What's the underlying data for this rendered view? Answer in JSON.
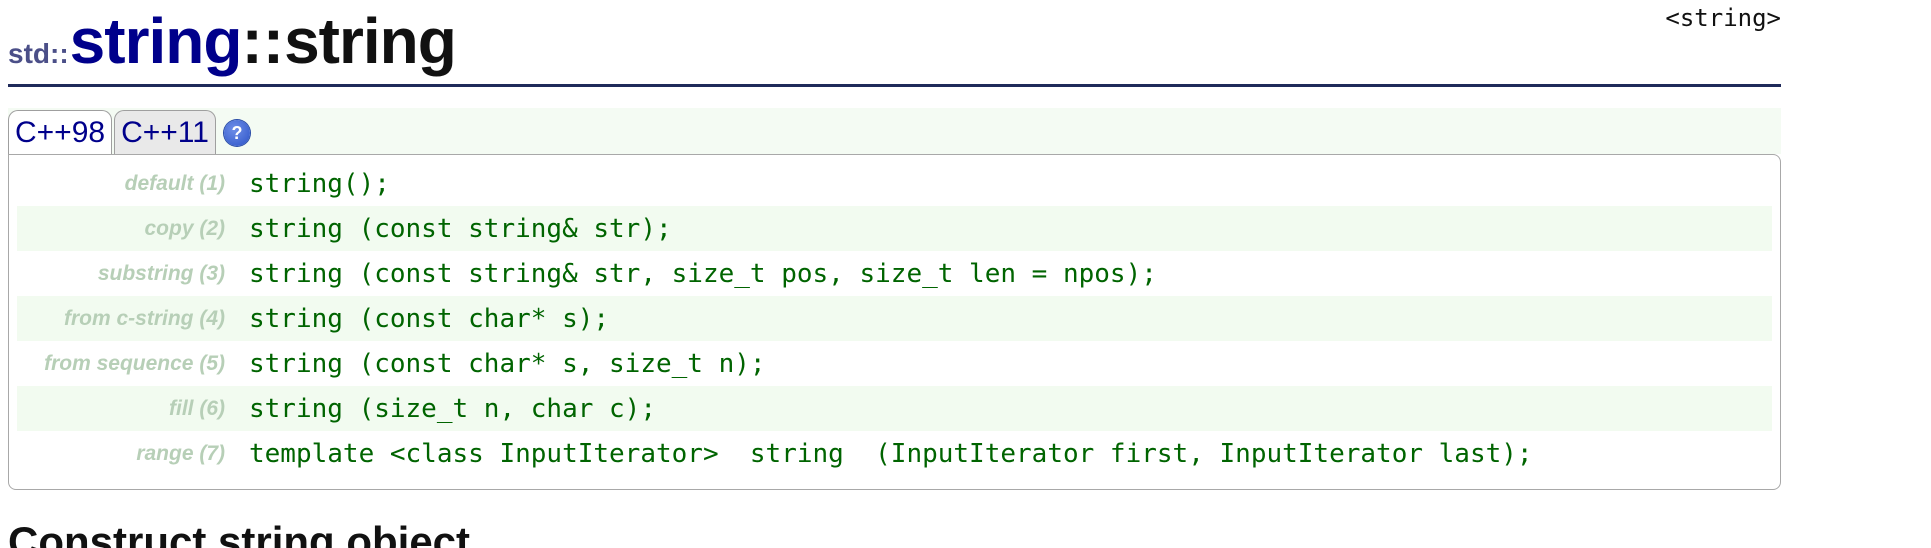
{
  "header": {
    "namespace": "std::",
    "class_name": "string",
    "separator": "::",
    "function_name": "string",
    "include": "<string>"
  },
  "tabs": [
    {
      "label": "C++98"
    },
    {
      "label": "C++11"
    }
  ],
  "help_icon": "?",
  "signatures": [
    {
      "label": "default (1)",
      "code": "string();"
    },
    {
      "label": "copy (2)",
      "code": "string (const string& str);"
    },
    {
      "label": "substring (3)",
      "code": "string (const string& str, size_t pos, size_t len = npos);"
    },
    {
      "label": "from c-string (4)",
      "code": "string (const char* s);"
    },
    {
      "label": "from sequence (5)",
      "code": "string (const char* s, size_t n);"
    },
    {
      "label": "fill (6)",
      "code": "string (size_t n, char c);"
    },
    {
      "label": "range (7)",
      "code": "template <class InputIterator>  string  (InputIterator first, InputIterator last);"
    }
  ],
  "section_title": "Construct string object",
  "colors": {
    "class_name": "#00008b",
    "code": "#006400",
    "label": "#b7cfb7",
    "alt_row": "#f2fbf0"
  }
}
